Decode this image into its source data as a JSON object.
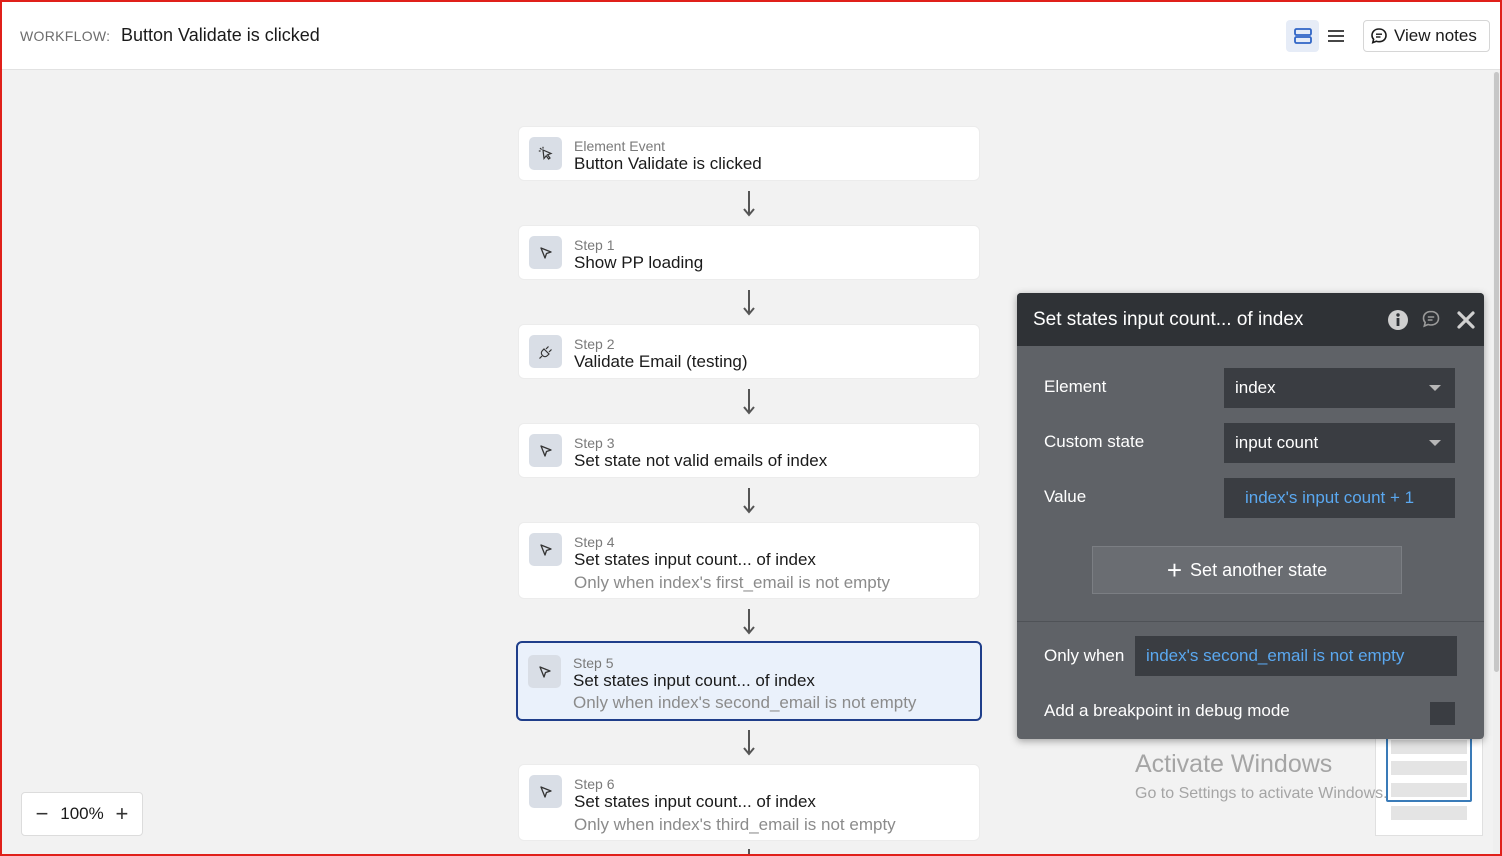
{
  "header": {
    "workflow_label": "WORKFLOW:",
    "workflow_title": "Button Validate is clicked",
    "view_notes_label": "View notes"
  },
  "steps": [
    {
      "label": "Element Event",
      "title": "Button Validate is clicked",
      "condition": "",
      "icon": "pointer-click-icon"
    },
    {
      "label": "Step 1",
      "title": "Show PP loading",
      "condition": "",
      "icon": "cursor-icon"
    },
    {
      "label": "Step 2",
      "title": "Validate Email (testing)",
      "condition": "",
      "icon": "plugin-icon"
    },
    {
      "label": "Step 3",
      "title": "Set state not valid emails of index",
      "condition": "",
      "icon": "cursor-icon"
    },
    {
      "label": "Step 4",
      "title": "Set states input count... of index",
      "condition": "Only when index's first_email is not empty",
      "icon": "cursor-icon"
    },
    {
      "label": "Step 5",
      "title": "Set states input count... of index",
      "condition": "Only when index's second_email is not empty",
      "icon": "cursor-icon"
    },
    {
      "label": "Step 6",
      "title": "Set states input count... of index",
      "condition": "Only when index's third_email is not empty",
      "icon": "cursor-icon"
    }
  ],
  "zoom": {
    "level": "100%",
    "minus": "−",
    "plus": "+"
  },
  "panel": {
    "title": "Set states input count... of index",
    "element_label": "Element",
    "element_value": "index",
    "custom_state_label": "Custom state",
    "custom_state_value": "input count",
    "value_label": "Value",
    "value_expression": "index's input count + 1",
    "add_state_label": "Set another state",
    "only_when_label": "Only when",
    "only_when_value": "index's second_email is not empty",
    "breakpoint_label": "Add a breakpoint in debug mode"
  },
  "watermark": {
    "line1": "Activate Windows",
    "line2": "Go to Settings to activate Windows."
  },
  "colors": {
    "selected_border": "#1f3e8a",
    "selected_bg": "#eaf1fb",
    "expression_blue": "#5aa8f0",
    "panel_bg": "#5f6267",
    "panel_header": "#2f3236"
  }
}
